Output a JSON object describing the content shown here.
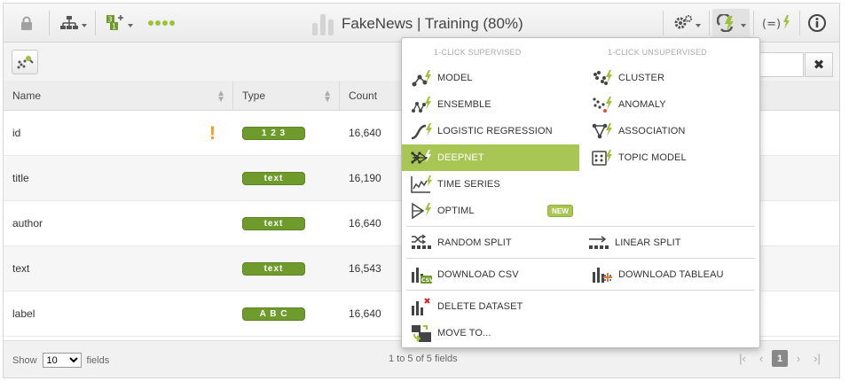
{
  "header": {
    "title": "FakeNews | Training (80%)"
  },
  "table": {
    "columns": [
      "Name",
      "Type",
      "Count"
    ],
    "rows": [
      {
        "name": "id",
        "type": "1 2 3",
        "count": "16,640",
        "warning": true
      },
      {
        "name": "title",
        "type": "text",
        "count": "16,190",
        "warning": false
      },
      {
        "name": "author",
        "type": "text",
        "count": "16,640",
        "warning": false
      },
      {
        "name": "text",
        "type": "text",
        "count": "16,543",
        "warning": false
      },
      {
        "name": "label",
        "type": "A B C",
        "count": "16,640",
        "warning": false
      }
    ]
  },
  "footer": {
    "show_label": "Show",
    "page_size": "10",
    "fields_label": "fields",
    "range_text": "1 to 5 of 5 fields",
    "current_page": "1"
  },
  "menu": {
    "supervised_header": "1-CLICK SUPERVISED",
    "unsupervised_header": "1-CLICK UNSUPERVISED",
    "supervised": [
      "MODEL",
      "ENSEMBLE",
      "LOGISTIC REGRESSION",
      "DEEPNET",
      "TIME SERIES",
      "OPTIML"
    ],
    "unsupervised": [
      "CLUSTER",
      "ANOMALY",
      "ASSOCIATION",
      "TOPIC MODEL"
    ],
    "new_badge": "NEW",
    "random_split": "RANDOM SPLIT",
    "linear_split": "LINEAR SPLIT",
    "download_csv": "DOWNLOAD CSV",
    "download_tableau": "DOWNLOAD TABLEAU",
    "delete_dataset": "DELETE DATASET",
    "move_to": "MOVE TO..."
  },
  "colors": {
    "accent_green": "#a8c654",
    "pill_green": "#6f9a2c",
    "warning_orange": "#f39c1a"
  }
}
